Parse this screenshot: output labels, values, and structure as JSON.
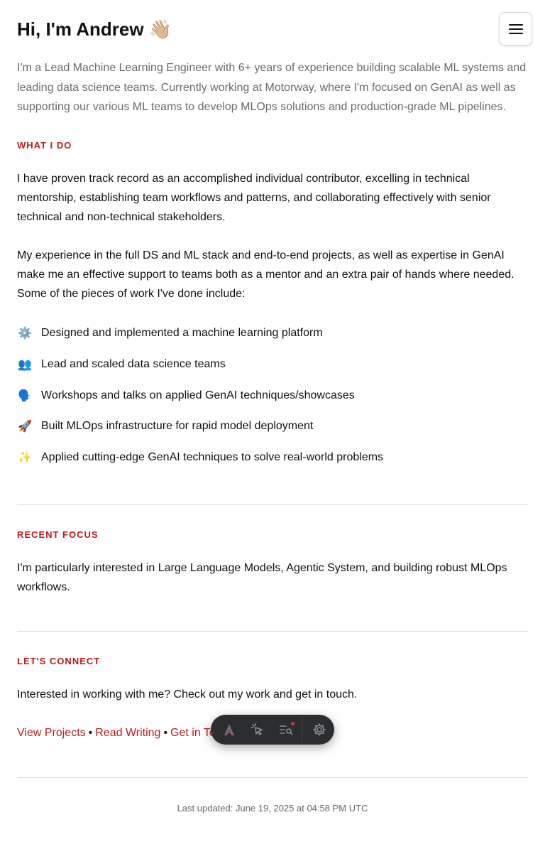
{
  "header": {
    "title": "Hi, I'm Andrew",
    "wave_emoji": "👋🏼",
    "menu_icon": "hamburger-menu-icon"
  },
  "intro": "I'm a Lead Machine Learning Engineer with 6+ years of experience building scalable ML systems and leading data science teams. Currently working at Motorway, where I'm focused on GenAI as well as supporting our various ML teams to develop MLOps solutions and production-grade ML pipelines.",
  "what_i_do": {
    "heading": "WHAT I DO",
    "paragraph1": "I have proven track record as an accomplished individual contributor, excelling in technical mentorship, establishing team workflows and patterns, and collaborating effectively with senior technical and non-technical stakeholders.",
    "paragraph2": "My experience in the full DS and ML stack and end-to-end projects, as well as expertise in GenAI make me an effective support to teams both as a mentor and an extra pair of hands where needed. Some of the pieces of work I've done include:",
    "items": [
      {
        "emoji": "⚙️",
        "icon": "gear-icon",
        "text": "Designed and implemented a machine learning platform"
      },
      {
        "emoji": "👥",
        "icon": "people-icon",
        "text": "Lead and scaled data science teams"
      },
      {
        "emoji": "🗣️",
        "icon": "speaking-head-icon",
        "text": "Workshops and talks on applied GenAI techniques/showcases"
      },
      {
        "emoji": "🚀",
        "icon": "rocket-icon",
        "text": "Built MLOps infrastructure for rapid model deployment"
      },
      {
        "emoji": "✨",
        "icon": "sparkles-icon",
        "text": "Applied cutting-edge GenAI techniques to solve real-world problems"
      }
    ]
  },
  "recent_focus": {
    "heading": "RECENT FOCUS",
    "text": "I'm particularly interested in Large Language Models, Agentic System, and building robust MLOps workflows."
  },
  "connect": {
    "heading": "LET'S CONNECT",
    "text": "Interested in working with me? Check out my work and get in touch.",
    "links": {
      "projects": "View Projects",
      "writing": "Read Writing",
      "contact": "Get in Touch",
      "separator": "•"
    }
  },
  "footer": "Last updated: June 19, 2025 at 04:58 PM UTC",
  "toolbar": {
    "icons": [
      "logo-icon",
      "cursor-select-icon",
      "search-list-icon",
      "settings-icon"
    ]
  },
  "colors": {
    "accent": "#b91c1c",
    "muted_text": "#6b6b6b",
    "toolbar_bg": "#2b2d31"
  }
}
